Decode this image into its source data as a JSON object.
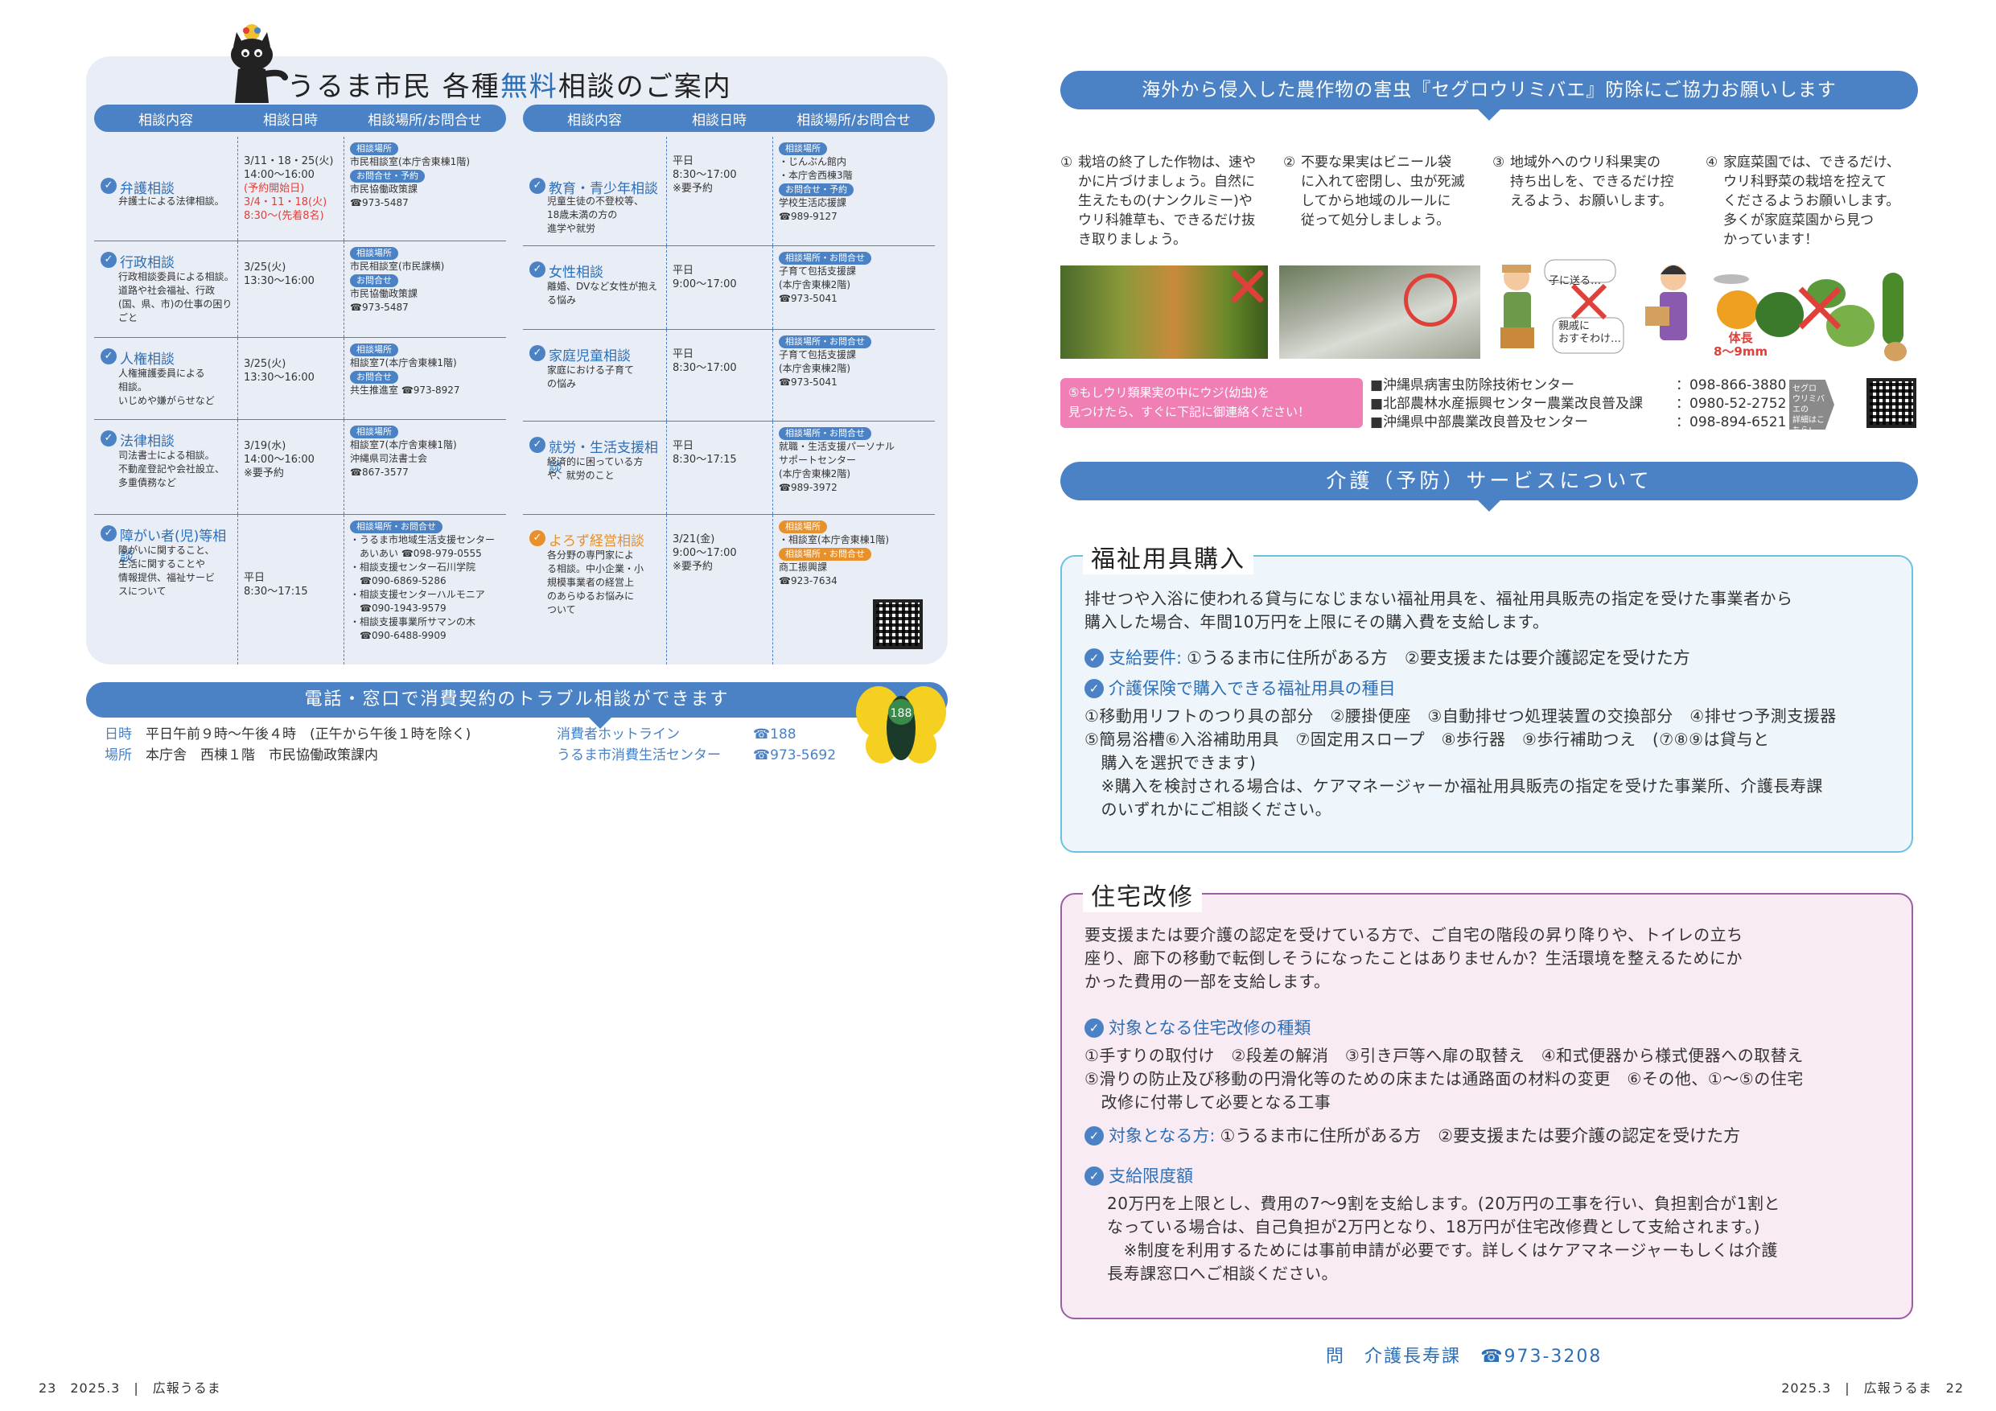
{
  "consult": {
    "title_prefix": "うるま市民 各種",
    "title_free": "無料",
    "title_suffix": "相談のご案内",
    "headers": [
      "相談内容",
      "相談日時",
      "相談場所/お問合せ"
    ],
    "left": [
      {
        "name": "弁護相談",
        "desc": [
          "弁護士による法律相談。"
        ],
        "date": [
          "3/11・18・25(火)",
          "14:00～16:00"
        ],
        "date_red": [
          "(予約開始日)",
          "3/4・11・18(火)",
          "8:30～(先着8名)"
        ],
        "tags": [
          "相談場所",
          "お問合せ・予約"
        ],
        "place1": [
          "市民相談室(本庁舎東棟1階)"
        ],
        "place2": [
          "市民協働政策課",
          "☎973-5487"
        ]
      },
      {
        "name": "行政相談",
        "desc": [
          "行政相談委員による相談。",
          "道路や社会福祉、行政",
          "(国、県、市)の仕事の困り",
          "ごと"
        ],
        "date": [
          "3/25(火)",
          "13:30～16:00"
        ],
        "date_red": [],
        "tags": [
          "相談場所",
          "お問合せ"
        ],
        "place1": [
          "市民相談室(市民課横)"
        ],
        "place2": [
          "市民協働政策課",
          "☎973-5487"
        ]
      },
      {
        "name": "人権相談",
        "desc": [
          "人権擁護委員による",
          "相談。",
          "いじめや嫌がらせなど"
        ],
        "date": [
          "3/25(火)",
          "13:30～16:00"
        ],
        "date_red": [],
        "tags": [
          "相談場所",
          "お問合せ"
        ],
        "place1": [
          "相談室7(本庁舎東棟1階)"
        ],
        "place2": [
          "共生推進室 ☎973-8927"
        ]
      },
      {
        "name": "法律相談",
        "desc": [
          "司法書士による相談。",
          "不動産登記や会社設立、",
          "多重債務など"
        ],
        "date": [
          "3/19(水)",
          "14:00～16:00",
          "※要予約"
        ],
        "date_red": [],
        "tags": [
          "相談場所"
        ],
        "place1": [
          "相談室7(本庁舎東棟1階)",
          "沖縄県司法書士会",
          "☎867-3577"
        ],
        "place2": []
      },
      {
        "name": "障がい者(児)等相談",
        "desc": [
          "障がいに関すること、",
          "生活に関することや",
          "情報提供、福祉サービ",
          "スについて"
        ],
        "date": [
          "平日",
          "8:30～17:15"
        ],
        "date_red": [],
        "tags": [
          "相談場所・お問合せ"
        ],
        "place1": [
          "・うるま市地域生活支援センター",
          "　あいあい ☎098-979-0555",
          "・相談支援センター石川学院",
          "　☎090-6869-5286",
          "・相談支援センターハルモニア",
          "　☎090-1943-9579",
          "・相談支援事業所サマンの木",
          "　☎090-6488-9909"
        ],
        "place2": []
      }
    ],
    "right": [
      {
        "name": "教育・青少年相談",
        "desc": [
          "児童生徒の不登校等、",
          "18歳未満の方の",
          "進学や就労"
        ],
        "date": [
          "平日",
          "8:30～17:00",
          "※要予約"
        ],
        "tags": [
          "相談場所",
          "お問合せ・予約"
        ],
        "place1": [
          "・じんぶん館内",
          "・本庁舎西棟3階"
        ],
        "place2": [
          "学校生活応援課",
          "☎989-9127"
        ]
      },
      {
        "name": "女性相談",
        "desc": [
          "離婚、DVなど女性が抱え",
          "る悩み"
        ],
        "date": [
          "平日",
          "9:00～17:00"
        ],
        "tags": [
          "相談場所・お問合せ"
        ],
        "place1": [
          "子育て包括支援課",
          "(本庁舎東棟2階)",
          "☎973-5041"
        ],
        "place2": []
      },
      {
        "name": "家庭児童相談",
        "desc": [
          "家庭における子育て",
          "の悩み"
        ],
        "date": [
          "平日",
          "8:30～17:00"
        ],
        "tags": [
          "相談場所・お問合せ"
        ],
        "place1": [
          "子育て包括支援課",
          "(本庁舎東棟2階)",
          "☎973-5041"
        ],
        "place2": []
      },
      {
        "name": "就労・生活支援相談",
        "desc": [
          "経済的に困っている方",
          "や、就労のこと"
        ],
        "date": [
          "平日",
          "8:30～17:15"
        ],
        "tags": [
          "相談場所・お問合せ"
        ],
        "place1": [
          "就職・生活支援パーソナル",
          "サポートセンター",
          "(本庁舎東棟2階)",
          "☎989-3972"
        ],
        "place2": []
      },
      {
        "name": "よろず経営相談",
        "desc": [
          "各分野の専門家によ",
          "る相談。中小企業・小",
          "規模事業者の経営上",
          "のあらゆるお悩みに",
          "ついて"
        ],
        "date": [
          "3/21(金)",
          "9:00～17:00",
          "※要予約"
        ],
        "tags": [
          "相談場所",
          "相談場所・お問合せ"
        ],
        "place1": [
          "・相談室(本庁舎東棟1階)"
        ],
        "place2": [
          "商工振興課",
          "☎923-7634"
        ]
      }
    ]
  },
  "trouble": {
    "title": "電話・窓口で消費契約のトラブル相談ができます",
    "date_label": "日時",
    "date_value": "平日午前９時～午後４時　(正午から午後１時を除く)",
    "place_label": "場所",
    "place_value": "本庁舎　西棟１階　市民協働政策課内",
    "hotline_label": "消費者ホットライン",
    "hotline_tel": "☎188",
    "center_label": "うるま市消費生活センター",
    "center_tel": "☎973-5692",
    "mascot_number": "188"
  },
  "pest": {
    "title": "海外から侵入した農作物の害虫『セグロウリミバエ』防除にご協力お願いします",
    "items": [
      {
        "num": "①",
        "lines": [
          "栽培の終了した作物は、速や",
          "かに片づけましょう。自然に",
          "生えたもの(ナンクルミー)や",
          "ウリ科雑草も、できるだけ抜",
          "き取りましょう。"
        ]
      },
      {
        "num": "②",
        "lines": [
          "不要な果実はビニール袋",
          "に入れて密閉し、虫が死滅",
          "してから地域のルールに",
          "従って処分しましょう。"
        ]
      },
      {
        "num": "③",
        "lines": [
          "地域外へのウリ科果実の",
          "持ち出しを、できるだけ控",
          "えるよう、お願いします。"
        ]
      },
      {
        "num": "④",
        "lines": [
          "家庭菜園では、できるだけ、",
          "ウリ科野菜の栽培を控えて",
          "くださるようお願いします。",
          "多くが家庭菜園から見つ",
          "かっています！"
        ]
      }
    ],
    "bubble1": "子に送る…",
    "bubble2": [
      "親戚に",
      "おすそわけ…"
    ],
    "size_label": "体長",
    "size_value": "8～9mm",
    "pink_notice": [
      "⑤もしウリ類果実の中にウジ(幼虫)を",
      "見つけたら、すぐに下記に御連絡ください！"
    ],
    "contacts": [
      {
        "name": "■沖縄県病害虫防除技術センター",
        "tel": "：098-866-3880"
      },
      {
        "name": "■北部農林水産振興センター農業改良普及課",
        "tel": "：0980-52-2752"
      },
      {
        "name": "■沖縄県中部農業改良普及センター",
        "tel": "：098-894-6521"
      }
    ],
    "arrow_text": [
      "セグロ",
      "ウリミバエの",
      "詳細はこちら!"
    ]
  },
  "care": {
    "title": "介護（予防）サービスについて",
    "welfare": {
      "title": "福祉用具購入",
      "intro": [
        "排せつや入浴に使われる貸与になじまない福祉用具を、福祉用具販売の指定を受けた事業者から",
        "購入した場合、年間10万円を上限にその購入費を支給します。"
      ],
      "req_head": "支給要件:",
      "req_text": "①うるま市に住所がある方　②要支援または要介護認定を受けた方",
      "types_head": "介護保険で購入できる福祉用具の種目",
      "types": [
        "①移動用リフトのつり具の部分　②腰掛便座　③自動排せつ処理装置の交換部分　④排せつ予測支援器",
        "⑤簡易浴槽⑥入浴補助用具　⑦固定用スロープ　⑧歩行器　⑨歩行補助つえ　(⑦⑧⑨は貸与と",
        "　購入を選択できます)",
        "　※購入を検討される場合は、ケアマネージャーか福祉用具販売の指定を受けた事業所、介護長寿課",
        "　のいずれかにご相談ください。"
      ]
    },
    "reform": {
      "title": "住宅改修",
      "intro": [
        "要支援または要介護の認定を受けている方で、ご自宅の階段の昇り降りや、トイレの立ち",
        "座り、廊下の移動で転倒しそうになったことはありませんか？生活環境を整えるためにか",
        "かった費用の一部を支給します。"
      ],
      "types_head": "対象となる住宅改修の種類",
      "types": [
        "①手すりの取付け　②段差の解消　③引き戸等へ扉の取替え　④和式便器から様式便器への取替え",
        "⑤滑りの防止及び移動の円滑化等のための床または通路面の材料の変更　⑥その他、①～⑤の住宅",
        "　改修に付帯して必要となる工事"
      ],
      "target_head": "対象となる方:",
      "target_text": "①うるま市に住所がある方　②要支援または要介護の認定を受けた方",
      "limit_head": "支給限度額",
      "limit": [
        "20万円を上限とし、費用の7～9割を支給します。(20万円の工事を行い、負担割合が1割と",
        "なっている場合は、自己負担が2万円となり、18万円が住宅改修費として支給されます。)",
        "　※制度を利用するためには事前申請が必要です。詳しくはケアマネージャーもしくは介護",
        "長寿課窓口へご相談ください。"
      ]
    },
    "contact_label": "問",
    "contact_dept": "介護長寿課",
    "contact_tel": "☎973-3208"
  },
  "footer": {
    "left_page": "23",
    "left_issue": "2025.3",
    "left_mag": "広報うるま",
    "right_issue": "2025.3",
    "right_mag": "広報うるま",
    "right_page": "22"
  },
  "colors": {
    "accent": "#4a82c5",
    "orange": "#e8902a",
    "red": "#e0403a",
    "pink": "#f07fb6",
    "cyan": "#6cc2de",
    "purple": "#9c5ca8"
  }
}
